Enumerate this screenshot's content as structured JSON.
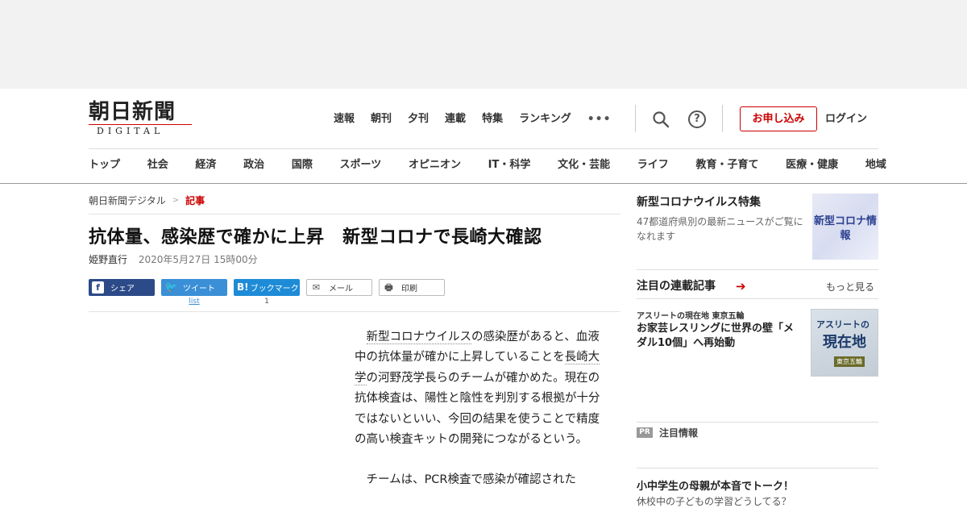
{
  "logo": {
    "main": "朝日新聞",
    "sub": "DIGITAL"
  },
  "top_nav": [
    "速報",
    "朝刊",
    "夕刊",
    "連載",
    "特集",
    "ランキング"
  ],
  "header": {
    "more": "•••",
    "help": "?",
    "subscribe": "お申し込み",
    "login": "ログイン"
  },
  "category_nav": [
    "トップ",
    "社会",
    "経済",
    "政治",
    "国際",
    "スポーツ",
    "オピニオン",
    "IT・科学",
    "文化・芸能",
    "ライフ",
    "教育・子育て",
    "医療・健康",
    "地域"
  ],
  "breadcrumb": {
    "home": "朝日新聞デジタル",
    "sep": ">",
    "current": "記事"
  },
  "article": {
    "title": "抗体量、感染歴で確かに上昇　新型コロナで長崎大確認",
    "author": "姫野直行",
    "date": "2020年5月27日 15時00分",
    "p1_link1": "新型コロナウイルス",
    "p1_a": "の感染歴があると、血液中の抗体量が確かに上昇していることを",
    "p1_link2": "長崎大学",
    "p1_b": "の河野茂学長らのチームが確かめた。現在の抗体検査は、陽性と陰性を判別する根拠が十分ではないといい、今回の結果を使うことで精度の高い検査キットの開発につながるという。",
    "p2": "チームは、PCR検査で感染が確認された"
  },
  "share": {
    "facebook": "シェア",
    "twitter": "ツイート",
    "twitter_count": "list",
    "hatena_mark": "B!",
    "hatena": "ブックマーク",
    "hatena_count": "1",
    "mail": "メール",
    "print": "印刷",
    "fb_glyph": "f",
    "tw_glyph": "🐦",
    "mail_glyph": "✉",
    "print_glyph": "🖶"
  },
  "sidebar": {
    "feature": {
      "title": "新型コロナウイルス特集",
      "desc": "47都道府県別の最新ニュースがご覧になれます",
      "image_text": "新型コロナ情報"
    },
    "serial": {
      "heading": "注目の連載記事",
      "arrow": "➔",
      "more": "もっと見る",
      "category": "アスリートの現在地 東京五輪",
      "title": "お家芸レスリングに世界の壁「メダル10個」へ再始動",
      "image_l1": "アスリートの",
      "image_l2": "現在地",
      "image_l3": "東京五輪"
    },
    "pr": {
      "badge": "PR",
      "label": "注目情報",
      "title": "小中学生の母親が本音でトーク！",
      "desc": "休校中の子どもの学習どうしてる？"
    }
  },
  "colors": {
    "brand_red": "#cc0000",
    "facebook": "#2b4a87",
    "twitter": "#3a8fd6",
    "hatena": "#1e8bd6"
  }
}
